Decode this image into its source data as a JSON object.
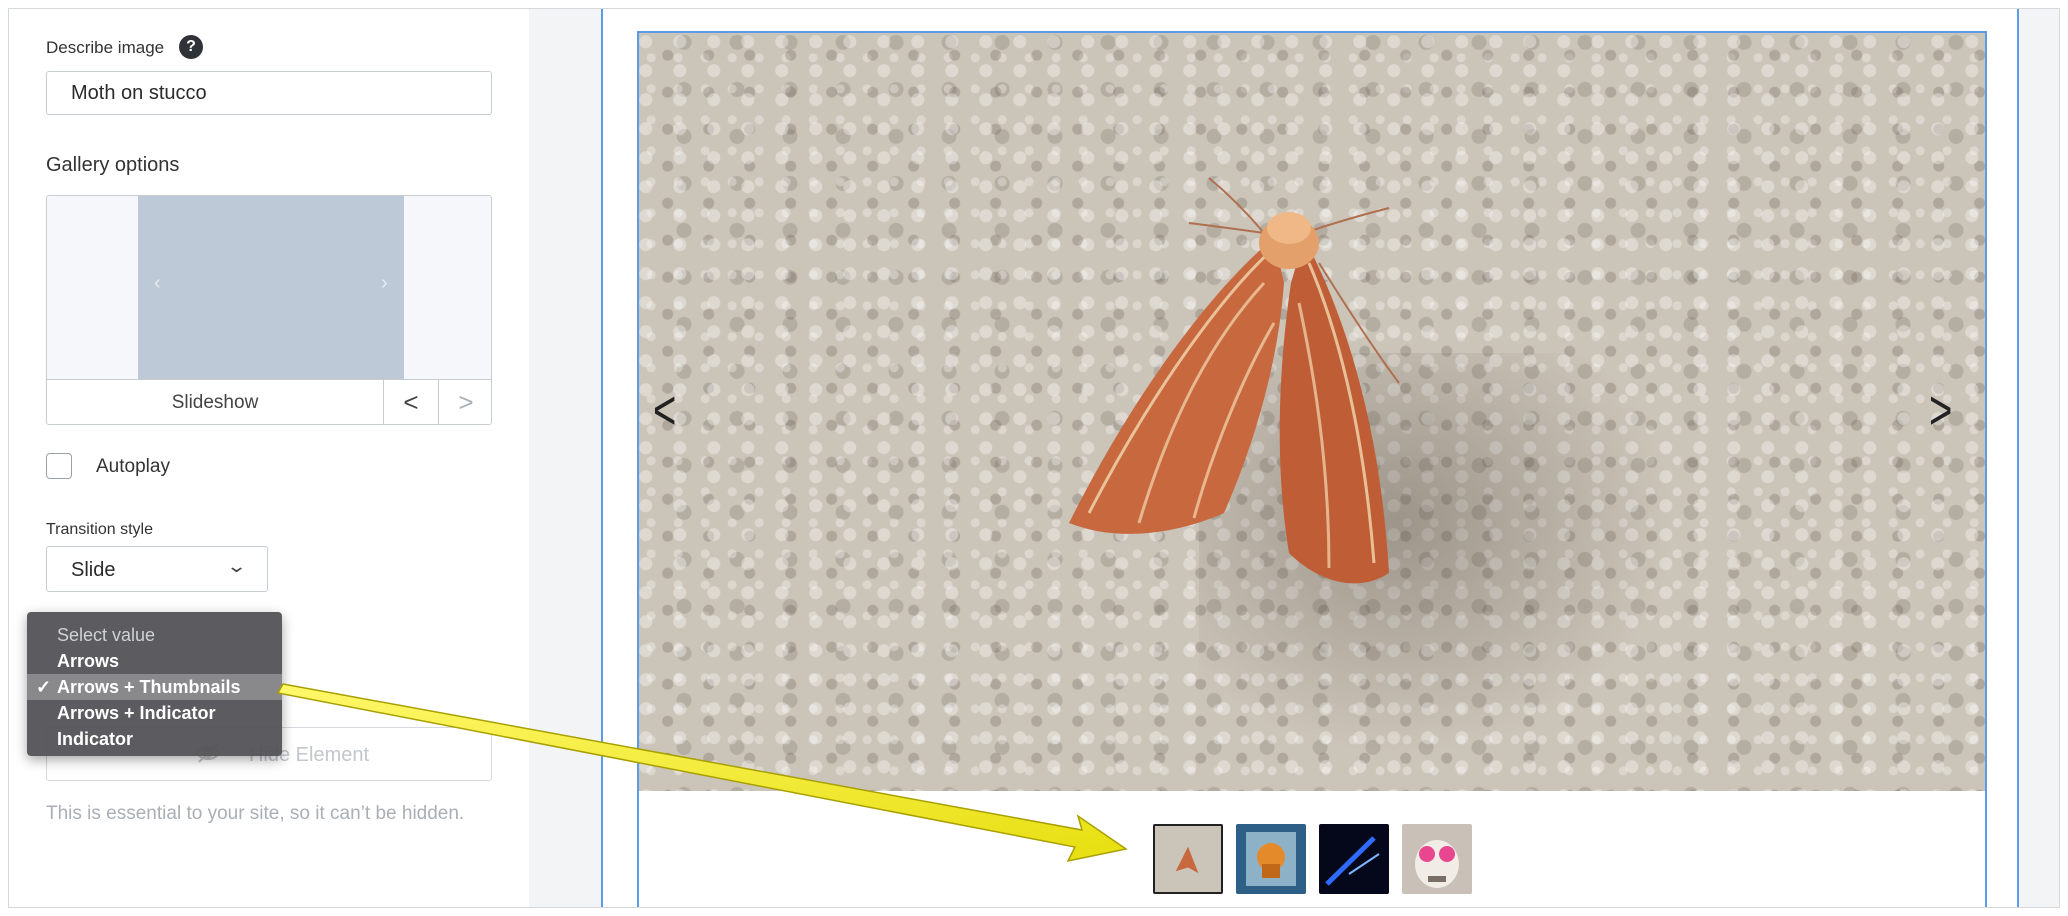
{
  "describe_image": {
    "label": "Describe image",
    "help_glyph": "?",
    "value": "Moth on stucco"
  },
  "gallery_options": {
    "label": "Gallery options",
    "preview_name": "Slideshow",
    "prev_glyph": "<",
    "next_glyph": ">"
  },
  "autoplay": {
    "label": "Autoplay",
    "checked": false
  },
  "transition": {
    "label": "Transition style",
    "value": "Slide"
  },
  "controls_dropdown": {
    "items": [
      {
        "label": "Select value",
        "placeholder": true
      },
      {
        "label": "Arrows"
      },
      {
        "label": "Arrows + Thumbnails",
        "selected": true
      },
      {
        "label": "Arrows + Indicator"
      },
      {
        "label": "Indicator"
      }
    ],
    "check_glyph": "✓"
  },
  "hide_element": {
    "label": "Hide Element",
    "help_text": "This is essential to your site, so it can’t be hidden."
  },
  "gallery": {
    "prev_glyph": "<",
    "next_glyph": ">",
    "thumbnails": [
      {
        "name": "thumbnail-moth",
        "active": true
      },
      {
        "name": "thumbnail-painting",
        "active": false
      },
      {
        "name": "thumbnail-neon",
        "active": false
      },
      {
        "name": "thumbnail-skull",
        "active": false
      }
    ]
  },
  "colors": {
    "accent_blue": "#5b9be8",
    "annotation_yellow": "#f4ee1e",
    "dropdown_bg": "#505054"
  }
}
